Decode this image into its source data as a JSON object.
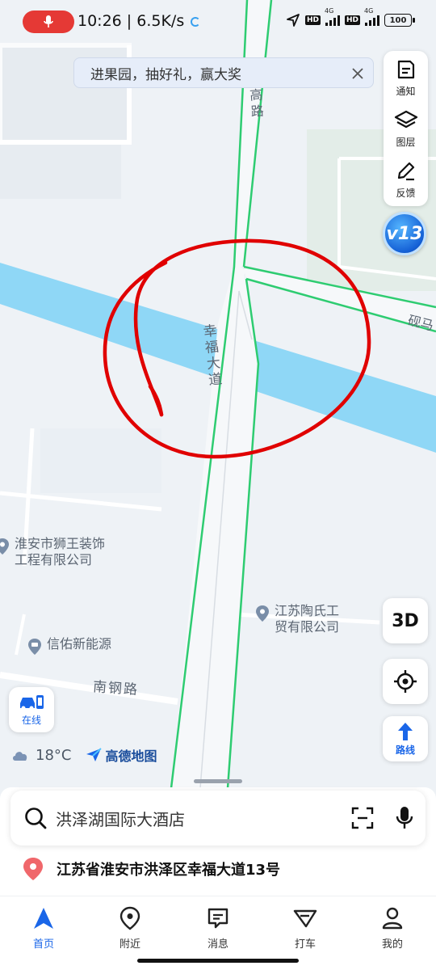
{
  "status_bar": {
    "time": "10:26",
    "net_speed": "6.5K/s",
    "hd_badge": "HD",
    "network": "4G",
    "battery": "100",
    "record_color": "#e53935"
  },
  "banner": {
    "text": "进果园，抽好礼，赢大奖",
    "close_icon": "close-icon"
  },
  "toolbar": {
    "notice_label": "通知",
    "layers_label": "图层",
    "feedback_label": "反馈",
    "version_badge": "v13"
  },
  "map": {
    "road_labels": {
      "main_road": "幸福大道",
      "top_road": "高路",
      "right_road": "砚马",
      "south_road": "南钢路"
    },
    "pois": [
      {
        "name_line1": "淮安市狮王装饰",
        "name_line2": "工程有限公司"
      },
      {
        "name_line1": "江苏陶氏工",
        "name_line2": "贸有限公司"
      },
      {
        "name_line1": "信佑新能源",
        "name_line2": ""
      }
    ],
    "colors": {
      "water": "#8fd7f6",
      "road_edge": "#2ecc71",
      "annotation": "#e00000",
      "background": "#eef2f6"
    }
  },
  "controls": {
    "three_d_label": "3D",
    "route_label": "路线",
    "online_label": "在线"
  },
  "weather": {
    "temperature": "18°C",
    "brand": "高德地图"
  },
  "search": {
    "placeholder": "洪泽湖国际大酒店"
  },
  "address": {
    "text": "江苏省淮安市洪泽区幸福大道13号"
  },
  "tabs": [
    {
      "label": "首页",
      "icon": "navigation-arrow-icon",
      "active": true
    },
    {
      "label": "附近",
      "icon": "location-pin-icon",
      "active": false
    },
    {
      "label": "消息",
      "icon": "message-icon",
      "active": false
    },
    {
      "label": "打车",
      "icon": "taxi-icon",
      "active": false
    },
    {
      "label": "我的",
      "icon": "person-icon",
      "active": false
    }
  ],
  "accent_color": "#1a66e8"
}
